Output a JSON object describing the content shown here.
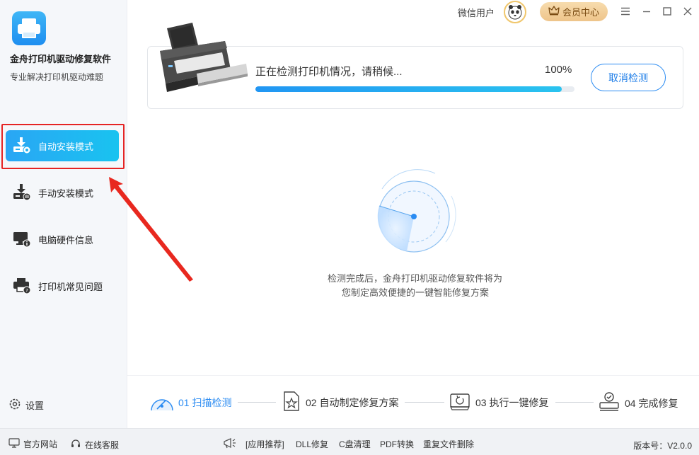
{
  "app": {
    "name": "金舟打印机驱动修复软件",
    "subtitle": "专业解决打印机驱动难题"
  },
  "sidebar": {
    "items": [
      {
        "label": "自动安装模式",
        "icon": "auto-install-icon",
        "active": true
      },
      {
        "label": "手动安装模式",
        "icon": "manual-install-icon",
        "active": false
      },
      {
        "label": "电脑硬件信息",
        "icon": "hardware-info-icon",
        "active": false
      },
      {
        "label": "打印机常见问题",
        "icon": "printer-faq-icon",
        "active": false
      }
    ],
    "settings_label": "设置"
  },
  "topbar": {
    "username": "微信用户",
    "vip_label": "会员中心"
  },
  "scan": {
    "status": "正在检测打印机情况，请稍候...",
    "percent_text": "100%",
    "progress": 0.96,
    "cancel_label": "取消检测"
  },
  "description": {
    "line1": "检测完成后，金舟打印机驱动修复软件将为",
    "line2": "您制定高效便捷的一键智能修复方案"
  },
  "steps": [
    {
      "label": "01 扫描检测",
      "icon": "scan-icon",
      "active": true
    },
    {
      "label": "02 自动制定修复方案",
      "icon": "plan-icon",
      "active": false
    },
    {
      "label": "03 执行一键修复",
      "icon": "repair-icon",
      "active": false
    },
    {
      "label": "04 完成修复",
      "icon": "complete-icon",
      "active": false
    }
  ],
  "footer": {
    "website": "官方网站",
    "support": "在线客服",
    "recommend": "[应用推荐]",
    "items": [
      "DLL修复",
      "C盘清理",
      "PDF转换",
      "重复文件删除"
    ],
    "version": "版本号：V2.0.0"
  },
  "colors": {
    "accent": "#2a8bf2",
    "active_nav": "#22b0f3",
    "vip": "#eec48a",
    "highlight": "#e52424"
  }
}
